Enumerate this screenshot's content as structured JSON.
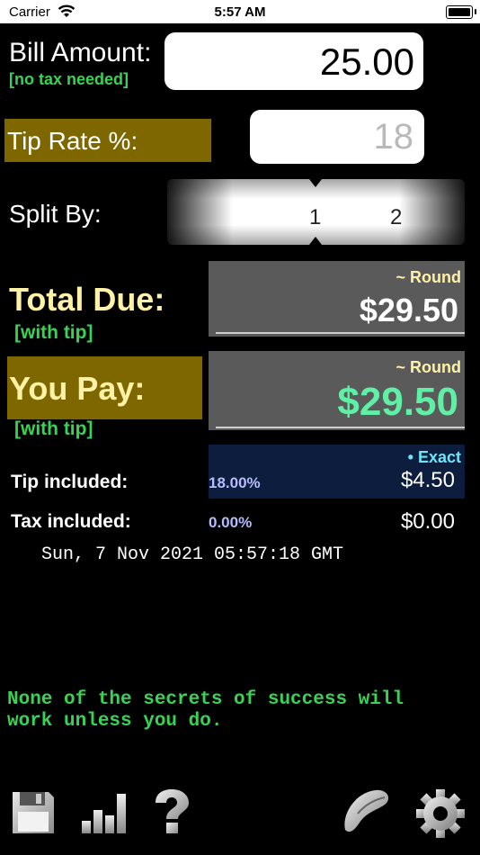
{
  "status_bar": {
    "carrier": "Carrier",
    "time": "5:57 AM",
    "icons": [
      "wifi-icon",
      "battery-icon"
    ]
  },
  "bill": {
    "label": "Bill Amount:",
    "note": "[no tax needed]",
    "value": "25.00"
  },
  "tip_rate": {
    "label": "Tip Rate %:",
    "placeholder": "18"
  },
  "split": {
    "label": "Split By:",
    "options": [
      "1",
      "2"
    ],
    "selected": "1"
  },
  "total_due": {
    "label": "Total Due:",
    "note": "[with tip]",
    "round_label": "~ Round",
    "value": "$29.50"
  },
  "you_pay": {
    "label": "You Pay:",
    "note": "[with tip]",
    "round_label": "~ Round",
    "value": "$29.50"
  },
  "breakdown": {
    "exact_label": "• Exact",
    "tip_label": "Tip included:",
    "tip_pct": "18.00%",
    "tip_amount": "$4.50",
    "tax_label": "Tax included:",
    "tax_pct": "0.00%",
    "tax_amount": "$0.00"
  },
  "datetime": "Sun, 7 Nov 2021 05:57:18 GMT",
  "fortune": {
    "line1": "None of the secrets of success will",
    "line2": "work unless you do."
  },
  "toolbar": {
    "icons": [
      "save-icon",
      "stats-icon",
      "help-icon",
      "fortune-cookie-icon",
      "settings-gear-icon"
    ]
  },
  "colors": {
    "accent_green": "#39d353",
    "pay_green": "#5ff0a6",
    "label_gold_bg": "#7f6700",
    "cream": "#fff2a6",
    "exact_bg": "#0c1d3d"
  }
}
